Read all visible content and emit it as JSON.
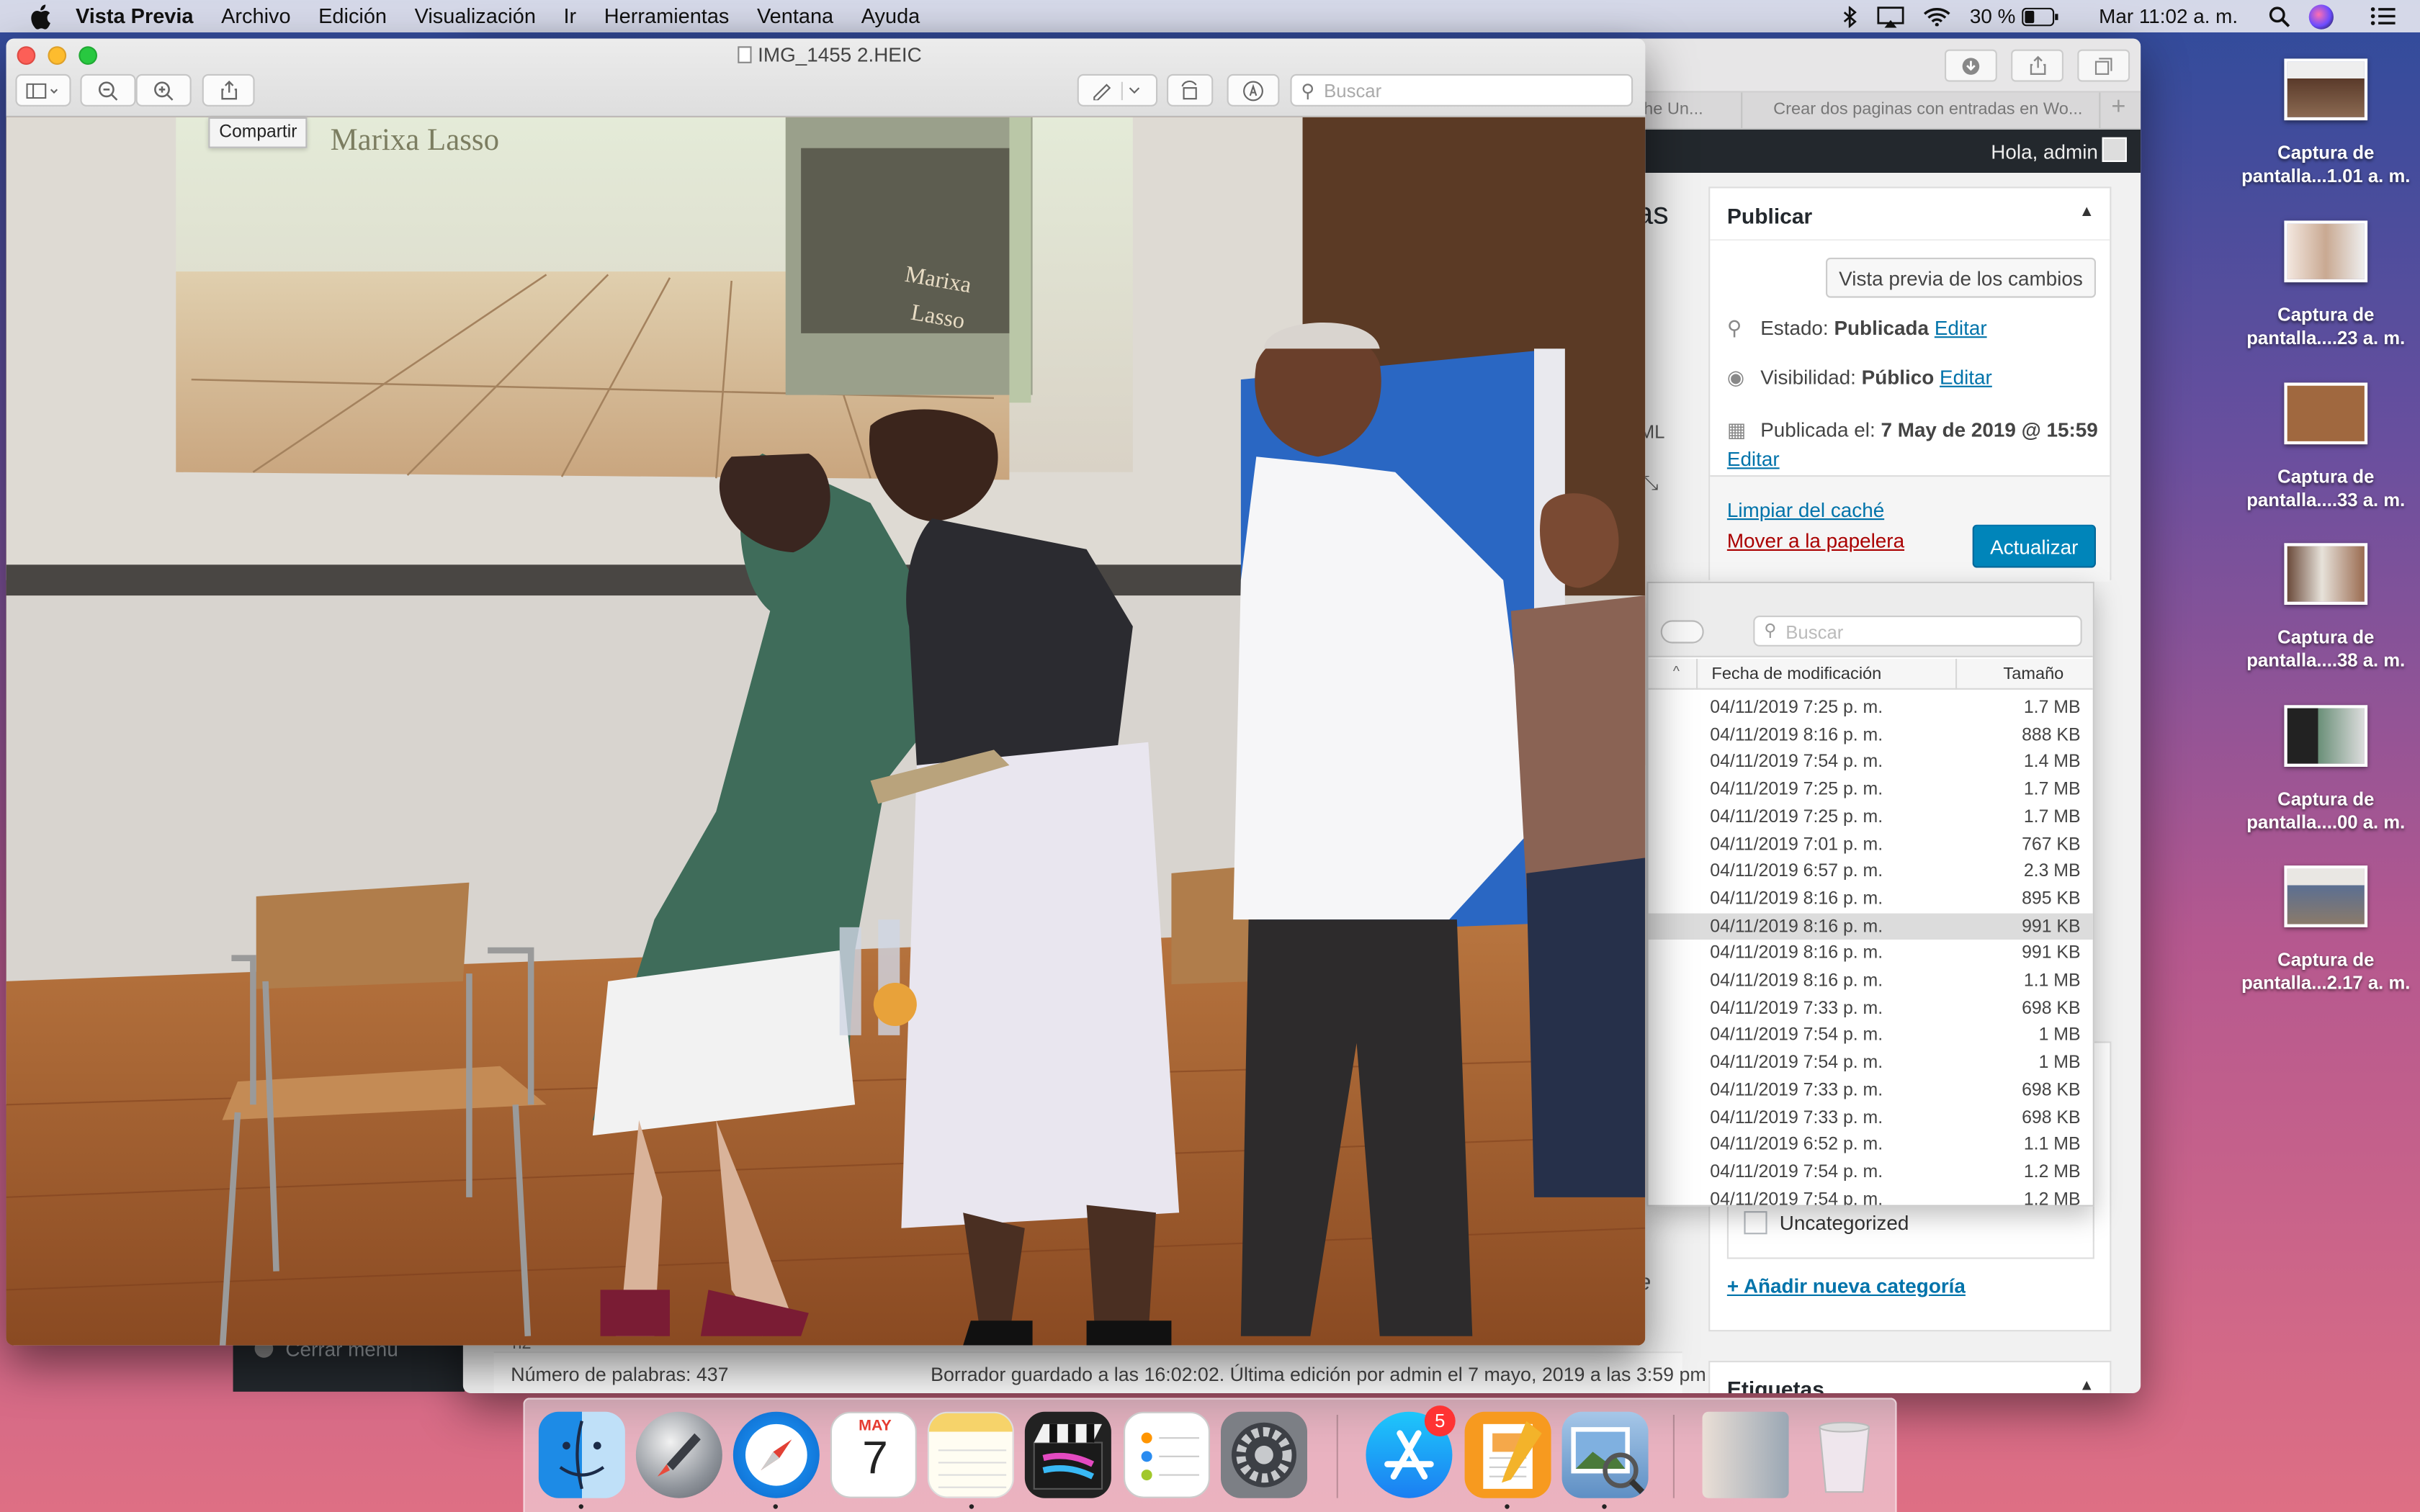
{
  "menubar": {
    "app_name": "Vista Previa",
    "items": [
      "Archivo",
      "Edición",
      "Visualización",
      "Ir",
      "Herramientas",
      "Ventana",
      "Ayuda"
    ],
    "battery": "30 %",
    "clock": "Mar 11:02 a. m."
  },
  "desktop_icons": [
    {
      "line1": "Captura de",
      "line2": "pantalla...1.01 a. m."
    },
    {
      "line1": "Captura de",
      "line2": "pantalla....23 a. m."
    },
    {
      "line1": "Captura de",
      "line2": "pantalla....33 a. m."
    },
    {
      "line1": "Captura de",
      "line2": "pantalla....38 a. m."
    },
    {
      "line1": "Captura de",
      "line2": "pantalla....00 a. m."
    },
    {
      "line1": "Captura de",
      "line2": "pantalla...2.17 a. m."
    }
  ],
  "preview": {
    "title": "IMG_1455 2.HEIC",
    "search_placeholder": "Buscar",
    "tooltip": "Compartir",
    "projection_text": "Marixa Lasso",
    "book_text_1": "Marixa",
    "book_text_2": "Lasso"
  },
  "wordpress": {
    "tab1": "he Un...",
    "tab2": "Crear dos paginas con entradas en Wo...",
    "greeting": "Hola, admin",
    "heading_fragment": "as",
    "html_fragment": "ML",
    "publish": {
      "title": "Publicar",
      "preview_button": "Vista previa de los cambios",
      "status_label": "Estado:",
      "status_value": "Publicada",
      "visibility_label": "Visibilidad:",
      "visibility_value": "Público",
      "published_label": "Publicada el:",
      "published_value": "7 May de 2019 @ 15:59",
      "edit": "Editar",
      "clear_cache": "Limpiar del caché",
      "trash": "Mover a la papelera",
      "update_button": "Actualizar"
    },
    "category": "Uncategorized",
    "add_category": "+ Añadir nueva categoría",
    "tags_title": "Etiquetas",
    "close_menu": "Cerrar menú",
    "word_count": "Número de palabras: 437",
    "draft_status": "Borrador guardado a las 16:02:02. Última edición por admin el 7 mayo, 2019 a las 3:59 pm",
    "side_letters": [
      "s",
      "le",
      "a"
    ],
    "h2": "h2"
  },
  "finder": {
    "search_placeholder": "Buscar",
    "col_date": "Fecha de modificación",
    "col_size": "Tamaño",
    "rows": [
      {
        "date": "04/11/2019 7:25 p. m.",
        "size": "1.7 MB"
      },
      {
        "date": "04/11/2019 8:16 p. m.",
        "size": "888 KB"
      },
      {
        "date": "04/11/2019 7:54 p. m.",
        "size": "1.4 MB"
      },
      {
        "date": "04/11/2019 7:25 p. m.",
        "size": "1.7 MB"
      },
      {
        "date": "04/11/2019 7:25 p. m.",
        "size": "1.7 MB"
      },
      {
        "date": "04/11/2019 7:01 p. m.",
        "size": "767 KB"
      },
      {
        "date": "04/11/2019 6:57 p. m.",
        "size": "2.3 MB"
      },
      {
        "date": "04/11/2019 8:16 p. m.",
        "size": "895 KB"
      },
      {
        "date": "04/11/2019 8:16 p. m.",
        "size": "991 KB"
      },
      {
        "date": "04/11/2019 8:16 p. m.",
        "size": "991 KB"
      },
      {
        "date": "04/11/2019 8:16 p. m.",
        "size": "1.1 MB"
      },
      {
        "date": "04/11/2019 7:33 p. m.",
        "size": "698 KB"
      },
      {
        "date": "04/11/2019 7:54 p. m.",
        "size": "1 MB"
      },
      {
        "date": "04/11/2019 7:54 p. m.",
        "size": "1 MB"
      },
      {
        "date": "04/11/2019 7:33 p. m.",
        "size": "698 KB"
      },
      {
        "date": "04/11/2019 7:33 p. m.",
        "size": "698 KB"
      },
      {
        "date": "04/11/2019 6:52 p. m.",
        "size": "1.1 MB"
      },
      {
        "date": "04/11/2019 7:54 p. m.",
        "size": "1.2 MB"
      },
      {
        "date": "04/11/2019 7:54 p. m.",
        "size": "1.2 MB"
      }
    ]
  },
  "dock": {
    "calendar_month": "MAY",
    "calendar_day": "7",
    "appstore_badge": "5",
    "apps": [
      "finder-icon",
      "launchpad-icon",
      "safari-icon",
      "calendar-icon",
      "notes-icon",
      "final-cut-icon",
      "reminders-icon",
      "system-preferences-icon",
      "app-store-icon",
      "pages-icon",
      "preview-icon",
      "screenshot-stack-icon",
      "trash-icon"
    ]
  }
}
